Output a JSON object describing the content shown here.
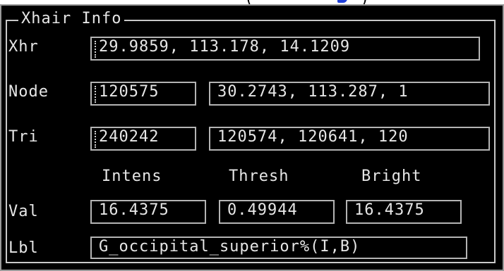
{
  "panel": {
    "title": "Xhair Info",
    "rows": {
      "xhr": {
        "label": "Xhr",
        "value": "29.9859, 113.178, 14.1209"
      },
      "node": {
        "label": "Node",
        "id": "120575",
        "coords": "30.2743, 113.287, 1"
      },
      "tri": {
        "label": "Tri",
        "id": "240242",
        "vertices": "120574, 120641, 120"
      },
      "headers": {
        "intens": "Intens",
        "thresh": "Thresh",
        "bright": "Bright"
      },
      "val": {
        "label": "Val",
        "intens": "16.4375",
        "thresh": "0.49944",
        "bright": "16.4375"
      },
      "lbl": {
        "label": "Lbl",
        "value": "G_occipital_superior%(I,B)"
      }
    }
  },
  "colors": {
    "background": "#000000",
    "text": "#e6e6e6",
    "field_border": "#b4b4b4",
    "frame_border": "#c8c8c8",
    "outer_border": "#9a9a9a"
  }
}
